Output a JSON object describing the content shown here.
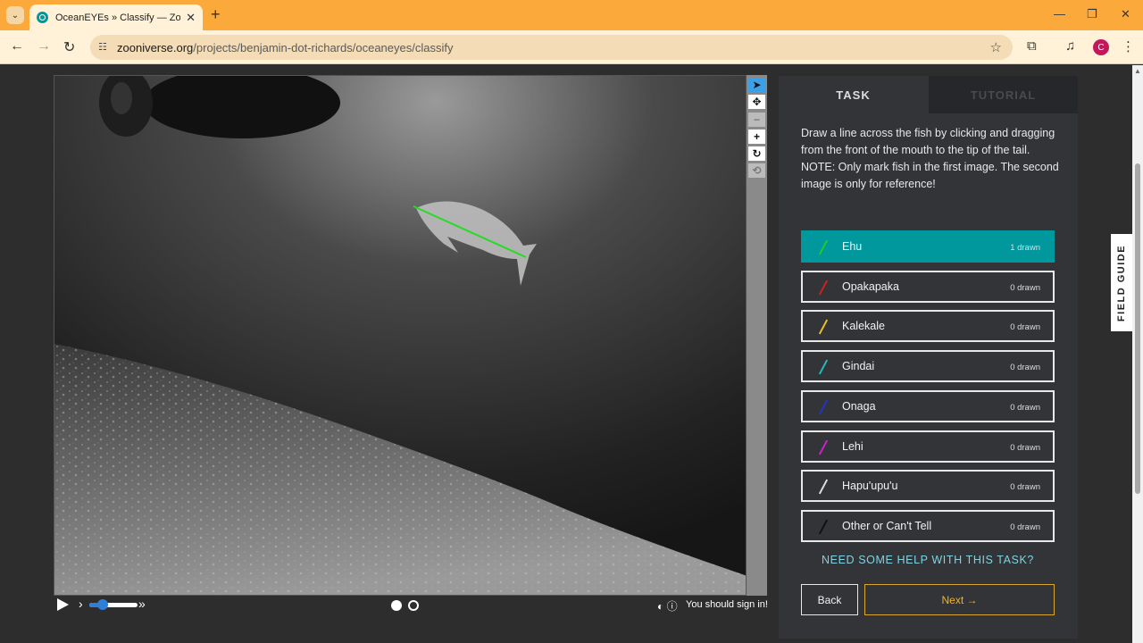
{
  "browser": {
    "tab_title": "OceanEYEs » Classify — Zooniverse",
    "url_host": "zooniverse.org",
    "url_path": "/projects/benjamin-dot-richards/oceaneyes/classify",
    "profile_initial": "C"
  },
  "viewer": {
    "tools": [
      "pointer-icon",
      "move-icon",
      "zoom-out-icon",
      "zoom-in-icon",
      "rotate-icon",
      "reset-icon"
    ],
    "active_tool": "pointer-icon",
    "frame_count": 2,
    "current_frame": 1,
    "signin_text": "You should sign in!"
  },
  "panel": {
    "tabs": [
      "TASK",
      "TUTORIAL"
    ],
    "active_tab": "TASK",
    "instruction": "Draw a line across the fish by clicking and dragging from the front of the mouth to the tip of the tail.",
    "note": "NOTE: Only mark fish in the first image. The second image is only for reference!",
    "answers": [
      {
        "label": "Ehu",
        "count": "1 drawn",
        "color": "#22cc22",
        "selected": true
      },
      {
        "label": "Opakapaka",
        "count": "0 drawn",
        "color": "#cc2222",
        "selected": false
      },
      {
        "label": "Kalekale",
        "count": "0 drawn",
        "color": "#e6c229",
        "selected": false
      },
      {
        "label": "Gindai",
        "count": "0 drawn",
        "color": "#22bbbb",
        "selected": false
      },
      {
        "label": "Onaga",
        "count": "0 drawn",
        "color": "#2233cc",
        "selected": false
      },
      {
        "label": "Lehi",
        "count": "0 drawn",
        "color": "#cc22cc",
        "selected": false
      },
      {
        "label": "Hapu'upu'u",
        "count": "0 drawn",
        "color": "#dddddd",
        "selected": false
      },
      {
        "label": "Other or Can't Tell",
        "count": "0 drawn",
        "color": "#111111",
        "selected": false
      }
    ],
    "help_link": "NEED SOME HELP WITH THIS TASK?",
    "back_label": "Back",
    "next_label": "Next →"
  },
  "field_guide_label": "FIELD GUIDE"
}
